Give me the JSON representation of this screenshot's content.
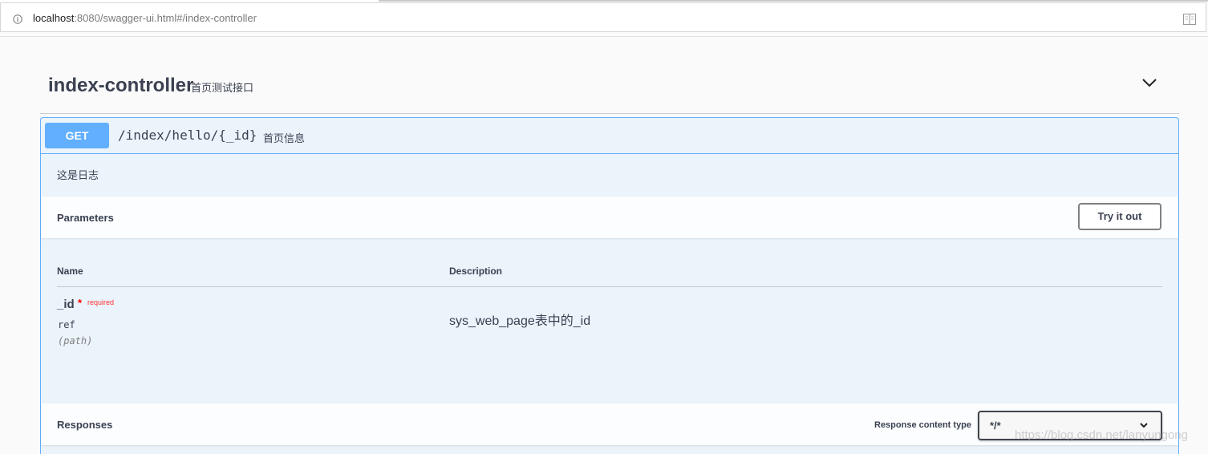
{
  "browser": {
    "url_host": "localhost",
    "url_rest": ":8080/swagger-ui.html#/index-controller",
    "icons": {
      "info": "info-icon",
      "reader": "reader-view-icon"
    }
  },
  "tag": {
    "name": "index-controller",
    "description": "首页测试接口",
    "toggle_icon": "chevron-down-icon"
  },
  "operation": {
    "method": "GET",
    "path": "/index/hello/{_id}",
    "summary": "首页信息",
    "description": "这是日志",
    "colors": {
      "get": "#61affe",
      "background": "#ebf3fb"
    }
  },
  "parameters": {
    "title": "Parameters",
    "try_button": "Try it out",
    "headers": {
      "name": "Name",
      "description": "Description"
    },
    "items": [
      {
        "name": "_id",
        "required_mark": "*",
        "required_label": "required",
        "type": "ref",
        "in": "(path)",
        "description": "sys_web_page表中的_id"
      }
    ]
  },
  "responses": {
    "title": "Responses",
    "content_type_label": "Response content type",
    "content_type_value": "*/*"
  },
  "watermark": "https://blog.csdn.net/lanyungong"
}
